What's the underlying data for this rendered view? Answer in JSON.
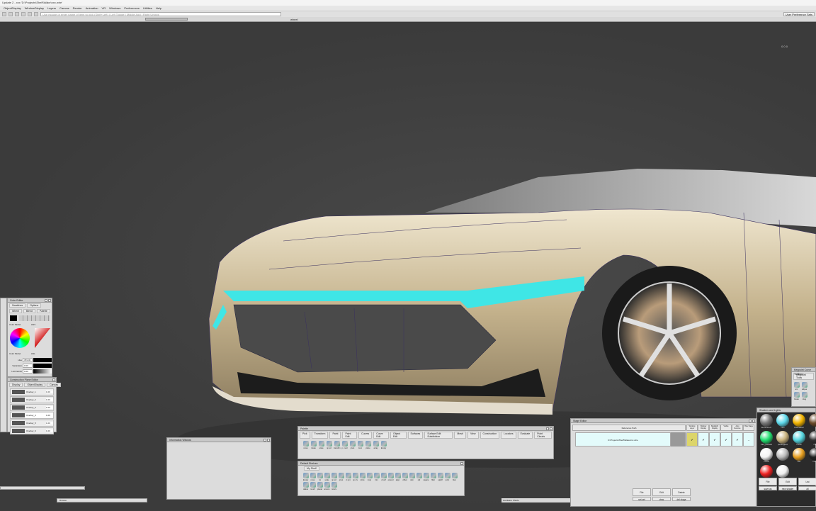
{
  "title": "Update 2  -  xxx  'D:\\Projects\\Shelf\\Wake\\xxx.wire'",
  "menu": [
    "ObjectDisplay",
    "WindowDisplay",
    "Layers",
    "Canvas",
    "Render",
    "Animation",
    "VR",
    "Windows",
    "Preferences",
    "Utilities",
    "Help"
  ],
  "toolbar": {
    "prompt_placeholder": "Use mouse or enter name of item to pick (Shift+Left) | Left Toggle | Middle Add | Right Unpick",
    "user_pref_sets": "User Preference Sets",
    "wheel_label": "wheel"
  },
  "viewport": {
    "coords": "0 0 0"
  },
  "color_editor": {
    "title": "Color Editor",
    "menus": [
      "Swatches",
      "Options"
    ],
    "tabs": [
      "Wheel",
      "Blend",
      "Palette"
    ],
    "color_model_label": "Color Model",
    "color_model_value": "HSV",
    "color_model2_value": "HSL",
    "fields": [
      {
        "label": "Hue",
        "value": "359.00"
      },
      {
        "label": "Saturation",
        "value": "0.00"
      },
      {
        "label": "Luminance",
        "value": "0.00"
      }
    ]
  },
  "construction_plane_editor": {
    "title": "Construction Plane Editor",
    "menus": [
      "Display",
      "ObjectDisplay",
      "Canvas"
    ],
    "rows": [
      {
        "name": "Overlay_1",
        "value": "1.00"
      },
      {
        "name": "Overlay_2",
        "value": "1.00"
      },
      {
        "name": "Overlay_3",
        "value": "1.00"
      },
      {
        "name": "Overlay_4",
        "value": "1.00"
      },
      {
        "name": "Overlay_5",
        "value": "1.00"
      },
      {
        "name": "Overlay_6",
        "value": "1.00"
      }
    ]
  },
  "info_window": {
    "title": "Information Window"
  },
  "browse_bar": {
    "label": "Browse"
  },
  "palette": {
    "title": "Palette",
    "tabs": [
      "Pick",
      "Transform",
      "Paint",
      "Paint Edit",
      "Curves",
      "Curve Edit",
      "Object Edit",
      "Surfaces",
      "Surface Edit Subdivision",
      "Mesh",
      "View",
      "Construction",
      "Locators",
      "Evaluate",
      "Point Clouds"
    ],
    "tools": [
      "move",
      "rotate",
      "scale",
      "np scl",
      "transfrm",
      "p. mod",
      "pivot",
      "zero",
      "plane",
      "array",
      "Empty"
    ]
  },
  "shelves": {
    "title": "Default Shelves",
    "tab": "My Shelf",
    "tools": [
      "Empty",
      "move",
      "rot",
      "scale",
      "np scl",
      "pivot",
      "ct pnt",
      "np crv",
      "circle",
      "kngt",
      "trim",
      "crvsrf",
      "extend",
      "align",
      "offset",
      "skin",
      "rail",
      "square",
      "fillet",
      "sqkdf",
      "pcirc",
      "blen",
      "delete",
      "revsrf",
      "planar",
      "amcon",
      "mdsrv"
    ]
  },
  "stage_editor": {
    "title": "Stage Editor",
    "header": "Reference Path",
    "columns": [
      "Working Layer",
      "Window Display",
      "Backlight Display",
      "Visible",
      "Auto Remove",
      "Hide Stage"
    ],
    "row_path": "D:\\Projects\\Shelf\\Wake\\xxx.wire",
    "row_flags": [
      "✔",
      "✔",
      "✔",
      "✔",
      "✔",
      "–"
    ],
    "buttons": [
      "File",
      "Edit",
      "Delete"
    ],
    "sub_buttons": [
      "set set",
      "view",
      "del stage"
    ]
  },
  "shaders": {
    "title": "Shaders and Lights",
    "names": [
      "Environment",
      "Lam",
      "BrushedFoil",
      "",
      "Cars_ExtPaint",
      "paintedglass",
      "HSHD",
      "HSL",
      "HSHD",
      "",
      "HSL",
      "HSHD",
      "HSHD",
      ""
    ],
    "buttons": [
      "File",
      "Edit",
      "List"
    ],
    "sub_buttons": [
      "save as",
      "new shader",
      "all"
    ]
  },
  "keypoint": {
    "title": "Keypoint Curve Toolbox",
    "tab": "Keypoint Tools",
    "tools": [
      "arc",
      "ellipse",
      "break",
      "drag"
    ]
  },
  "status": {
    "shade_mode": "Hardware Shade"
  },
  "colors": {
    "body": "#c9b894",
    "light_strip": "#3fe6e6",
    "viewport": "#3c3c3c"
  }
}
